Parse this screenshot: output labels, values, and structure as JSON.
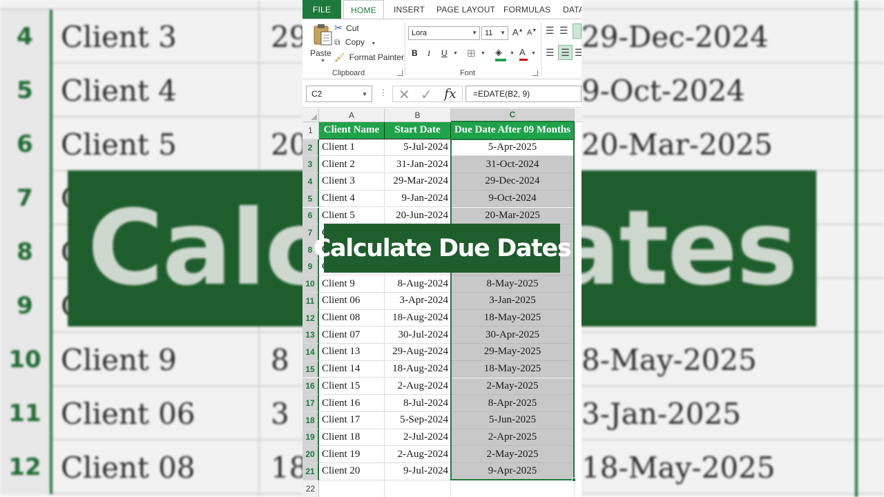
{
  "ribbon": {
    "tabs": [
      "FILE",
      "HOME",
      "INSERT",
      "PAGE LAYOUT",
      "FORMULAS",
      "DATA"
    ],
    "active_tab": "HOME",
    "clipboard": {
      "paste_label": "Paste",
      "cut_label": "Cut",
      "copy_label": "Copy",
      "format_painter_label": "Format Painter",
      "group_label": "Clipboard"
    },
    "font": {
      "font_name": "Lora",
      "font_size": "11",
      "bold": "B",
      "italic": "I",
      "underline": "U",
      "font_color_glyph": "A",
      "grow_glyph": "A",
      "shrink_glyph": "A",
      "group_label": "Font"
    }
  },
  "formula_bar": {
    "name_box": "C2",
    "formula": "=EDATE(B2, 9)"
  },
  "sheet": {
    "columns": [
      "A",
      "B",
      "C"
    ],
    "header_row": {
      "row": "1",
      "client": "Client Name",
      "start": "Start Date",
      "due": "Due Date After 09 Months"
    },
    "rows": [
      {
        "row": "2",
        "client": "Client 1",
        "start": "5-Jul-2024",
        "due": "5-Apr-2025"
      },
      {
        "row": "3",
        "client": "Client 2",
        "start": "31-Jan-2024",
        "due": "31-Oct-2024"
      },
      {
        "row": "4",
        "client": "Client 3",
        "start": "29-Mar-2024",
        "due": "29-Dec-2024"
      },
      {
        "row": "5",
        "client": "Client 4",
        "start": "9-Jan-2024",
        "due": "9-Oct-2024"
      },
      {
        "row": "6",
        "client": "Client 5",
        "start": "20-Jun-2024",
        "due": "20-Mar-2025"
      },
      {
        "row": "7",
        "client": "C",
        "start": "",
        "due": ""
      },
      {
        "row": "8",
        "client": "C",
        "start": "",
        "due": ""
      },
      {
        "row": "9",
        "client": "C",
        "start": "",
        "due": ""
      },
      {
        "row": "10",
        "client": "Client 9",
        "start": "8-Aug-2024",
        "due": "8-May-2025"
      },
      {
        "row": "11",
        "client": "Client 06",
        "start": "3-Apr-2024",
        "due": "3-Jan-2025"
      },
      {
        "row": "12",
        "client": "Client 08",
        "start": "18-Aug-2024",
        "due": "18-May-2025"
      },
      {
        "row": "13",
        "client": "Client 07",
        "start": "30-Jul-2024",
        "due": "30-Apr-2025"
      },
      {
        "row": "14",
        "client": "Client 13",
        "start": "29-Aug-2024",
        "due": "29-May-2025"
      },
      {
        "row": "15",
        "client": "Client 14",
        "start": "18-Aug-2024",
        "due": "18-May-2025"
      },
      {
        "row": "16",
        "client": "Client 15",
        "start": "2-Aug-2024",
        "due": "2-May-2025"
      },
      {
        "row": "17",
        "client": "Client 16",
        "start": "8-Jul-2024",
        "due": "8-Apr-2025"
      },
      {
        "row": "18",
        "client": "Client 17",
        "start": "5-Sep-2024",
        "due": "5-Jun-2025"
      },
      {
        "row": "19",
        "client": "Client 18",
        "start": "2-Jul-2024",
        "due": "2-Apr-2025"
      },
      {
        "row": "20",
        "client": "Client 19",
        "start": "2-Aug-2024",
        "due": "2-May-2025"
      },
      {
        "row": "21",
        "client": "Client 20",
        "start": "9-Jul-2024",
        "due": "9-Apr-2025"
      }
    ],
    "empty_row": "22"
  },
  "overlay": {
    "title": "Calculate Due Dates"
  },
  "background": {
    "banner_text": "Calcul                Dates",
    "left_rows": [
      {
        "row": "4",
        "client": "Client 3",
        "start": "29"
      },
      {
        "row": "5",
        "client": "Client 4",
        "start": ""
      },
      {
        "row": "6",
        "client": "Client 5",
        "start": "20"
      },
      {
        "row": "7",
        "client": "C",
        "start": ""
      },
      {
        "row": "8",
        "client": "C",
        "start": ""
      },
      {
        "row": "9",
        "client": "C",
        "start": ""
      },
      {
        "row": "10",
        "client": "Client 9",
        "start": "8"
      },
      {
        "row": "11",
        "client": "Client 06",
        "start": "3"
      },
      {
        "row": "12",
        "client": "Client 08",
        "start": "18"
      }
    ],
    "right_rows": [
      "29-Dec-2024",
      "9-Oct-2024",
      "20-Mar-2025",
      "",
      "",
      "",
      "8-May-2025",
      "3-Jan-2025",
      "18-May-2025"
    ]
  },
  "colors": {
    "excel_green": "#1e7a3c",
    "header_green": "#1fa34a",
    "banner_green": "#1e5e2c",
    "selection_gray": "#c8c8c8"
  }
}
